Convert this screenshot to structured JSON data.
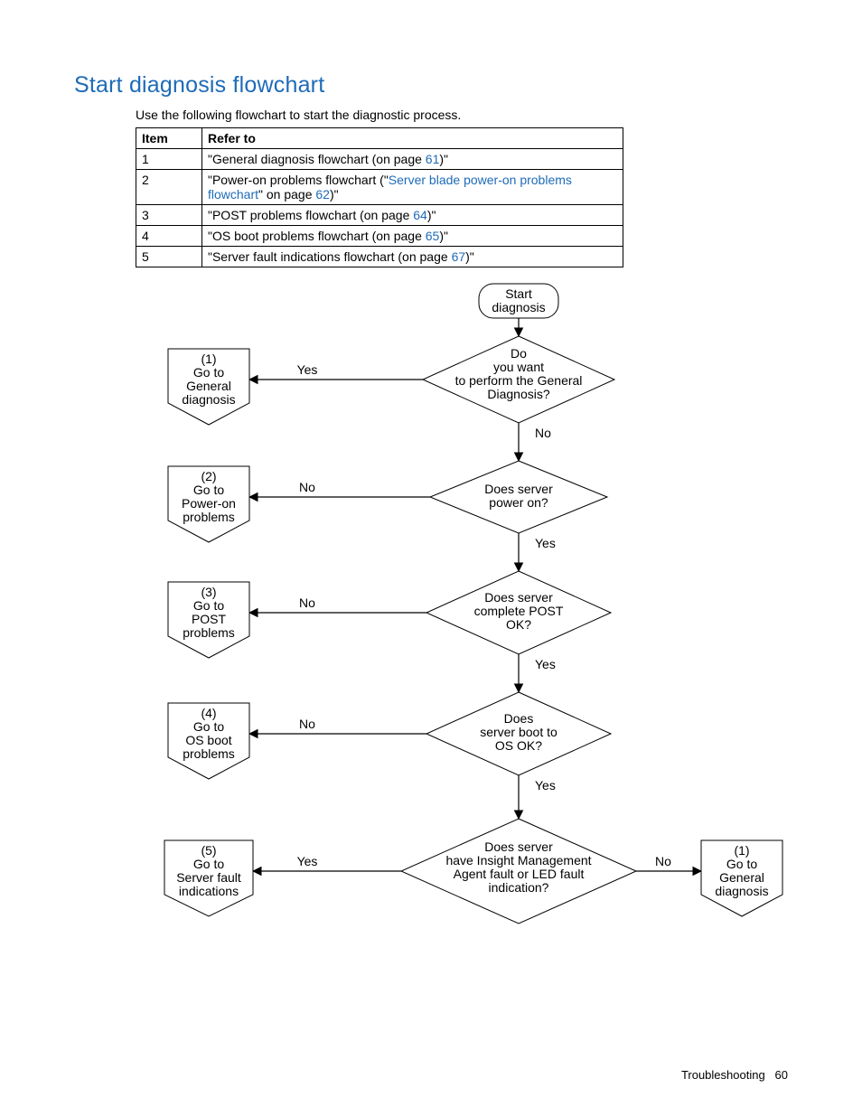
{
  "title": "Start diagnosis flowchart",
  "intro": "Use the following flowchart to start the diagnostic process.",
  "table": {
    "headers": {
      "item": "Item",
      "refer": "Refer to"
    },
    "rows": [
      {
        "item": "1",
        "pre": "\"General diagnosis flowchart (on page ",
        "link": "61",
        "post": ")\""
      },
      {
        "item": "2",
        "pre": "\"Power-on problems flowchart (\"",
        "link": "Server blade power-on problems flowchart",
        "mid": "\" on page ",
        "link2": "62",
        "post": ")\""
      },
      {
        "item": "3",
        "pre": "\"POST problems flowchart (on page ",
        "link": "64",
        "post": ")\""
      },
      {
        "item": "4",
        "pre": "\"OS boot problems flowchart (on page ",
        "link": "65",
        "post": ")\""
      },
      {
        "item": "5",
        "pre": "\"Server fault indications flowchart (on page ",
        "link": "67",
        "post": ")\""
      }
    ]
  },
  "flow": {
    "start_l1": "Start",
    "start_l2": "diagnosis",
    "d1_l1": "Do",
    "d1_l2": "you want",
    "d1_l3": "to perform the General",
    "d1_l4": "Diagnosis?",
    "d2_l1": "Does server",
    "d2_l2": "power on?",
    "d3_l1": "Does server",
    "d3_l2": "complete POST",
    "d3_l3": "OK?",
    "d4_l1": "Does",
    "d4_l2": "server boot to",
    "d4_l3": "OS OK?",
    "d5_l1": "Does server",
    "d5_l2": "have Insight Management",
    "d5_l3": "Agent fault or LED fault",
    "d5_l4": "indication?",
    "yes": "Yes",
    "no": "No",
    "o1_l1": "(1)",
    "o1_l2": "Go to",
    "o1_l3": "General",
    "o1_l4": "diagnosis",
    "o2_l1": "(2)",
    "o2_l2": "Go to",
    "o2_l3": "Power-on",
    "o2_l4": "problems",
    "o3_l1": "(3)",
    "o3_l2": "Go to",
    "o3_l3": "POST",
    "o3_l4": "problems",
    "o4_l1": "(4)",
    "o4_l2": "Go to",
    "o4_l3": "OS boot",
    "o4_l4": "problems",
    "o5_l1": "(5)",
    "o5_l2": "Go to",
    "o5_l3": "Server fault",
    "o5_l4": "indications",
    "o6_l1": "(1)",
    "o6_l2": "Go to",
    "o6_l3": "General",
    "o6_l4": "diagnosis"
  },
  "footer": {
    "section": "Troubleshooting",
    "page": "60"
  }
}
